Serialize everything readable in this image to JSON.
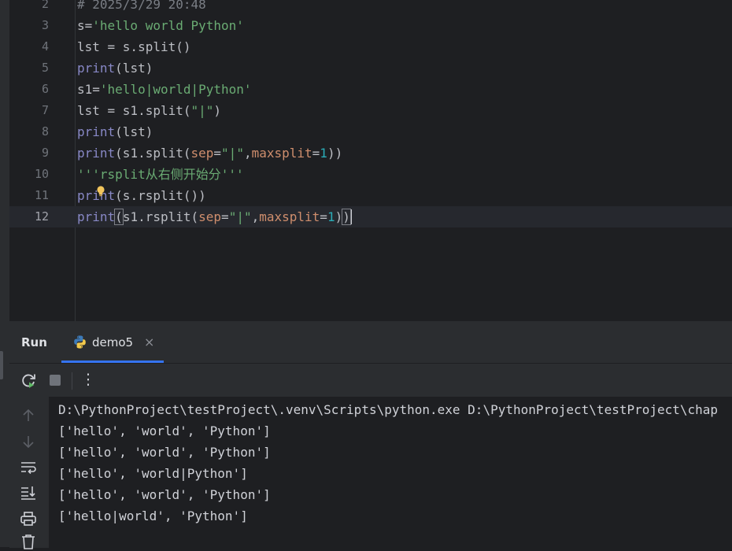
{
  "editor": {
    "lines": [
      {
        "num": "2",
        "parts": [
          {
            "t": "# 2025/3/29 20:48",
            "c": "cmt"
          }
        ]
      },
      {
        "num": "3",
        "parts": [
          {
            "t": "s=",
            "c": ""
          },
          {
            "t": "'hello world Python'",
            "c": "str"
          }
        ]
      },
      {
        "num": "4",
        "parts": [
          {
            "t": "lst = s.split()",
            "c": ""
          }
        ]
      },
      {
        "num": "5",
        "parts": [
          {
            "t": "print",
            "c": "kw"
          },
          {
            "t": "(lst)",
            "c": ""
          }
        ]
      },
      {
        "num": "6",
        "parts": [
          {
            "t": "s1=",
            "c": ""
          },
          {
            "t": "'hello|world|Python'",
            "c": "str"
          }
        ]
      },
      {
        "num": "7",
        "parts": [
          {
            "t": "lst = s1.split(",
            "c": ""
          },
          {
            "t": "\"|\"",
            "c": "str"
          },
          {
            "t": ")",
            "c": ""
          }
        ]
      },
      {
        "num": "8",
        "parts": [
          {
            "t": "print",
            "c": "kw"
          },
          {
            "t": "(lst)",
            "c": ""
          }
        ]
      },
      {
        "num": "9",
        "parts": [
          {
            "t": "print",
            "c": "kw"
          },
          {
            "t": "(s1.split(",
            "c": ""
          },
          {
            "t": "sep",
            "c": "prm"
          },
          {
            "t": "=",
            "c": ""
          },
          {
            "t": "\"|\"",
            "c": "str"
          },
          {
            "t": ",",
            "c": ""
          },
          {
            "t": "maxsplit",
            "c": "prm"
          },
          {
            "t": "=",
            "c": ""
          },
          {
            "t": "1",
            "c": "num"
          },
          {
            "t": "))",
            "c": ""
          }
        ]
      },
      {
        "num": "10",
        "parts": [
          {
            "t": "'''rsplit从右侧开始分'''",
            "c": "str"
          }
        ]
      },
      {
        "num": "11",
        "parts": [
          {
            "t": "print",
            "c": "kw"
          },
          {
            "t": "(s.rsplit())",
            "c": ""
          }
        ]
      },
      {
        "num": "12",
        "active": true,
        "parts": [
          {
            "t": "print",
            "c": "kw"
          },
          {
            "t": "(",
            "c": "brk"
          },
          {
            "t": "s1.rsplit(",
            "c": ""
          },
          {
            "t": "sep",
            "c": "prm"
          },
          {
            "t": "=",
            "c": ""
          },
          {
            "t": "\"|\"",
            "c": "str"
          },
          {
            "t": ",",
            "c": ""
          },
          {
            "t": "maxsplit",
            "c": "prm"
          },
          {
            "t": "=",
            "c": ""
          },
          {
            "t": "1",
            "c": "num"
          },
          {
            "t": ")",
            "c": ""
          },
          {
            "t": ")",
            "c": "brk"
          }
        ]
      }
    ]
  },
  "run": {
    "title": "Run",
    "tab_label": "demo5",
    "tab_close": "×",
    "menu_glyph": "⋮",
    "output": [
      "D:\\PythonProject\\testProject\\.venv\\Scripts\\python.exe D:\\PythonProject\\testProject\\chap",
      "['hello', 'world', 'Python']",
      "['hello', 'world', 'Python']",
      "['hello', 'world|Python']",
      "['hello', 'world', 'Python']",
      "['hello|world', 'Python']"
    ]
  },
  "colors": {
    "background": "#1e1f22",
    "panel": "#2b2d30",
    "keyword": "#8888c6",
    "string": "#6aab73",
    "param": "#cf8e6d",
    "number": "#2aacb8",
    "tab_underline": "#3574f0"
  },
  "icons": [
    "lightbulb-icon",
    "python-icon",
    "rerun-icon",
    "stop-icon",
    "more-icon",
    "scroll-up-icon",
    "scroll-down-icon",
    "soft-wrap-icon",
    "scroll-to-end-icon",
    "print-icon",
    "trash-icon"
  ]
}
